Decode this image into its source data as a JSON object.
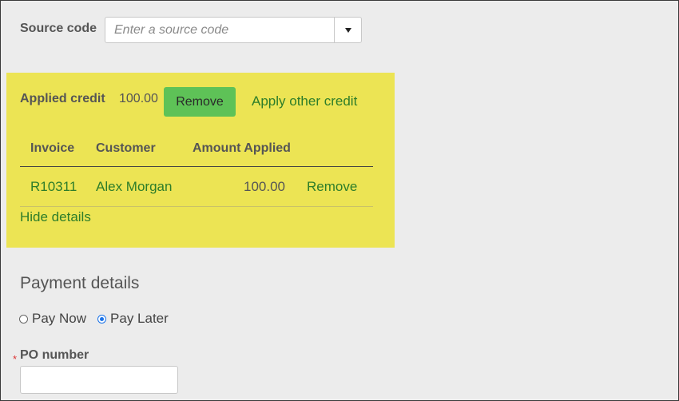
{
  "source_code": {
    "label": "Source code",
    "placeholder": "Enter a source code",
    "value": ""
  },
  "credit": {
    "applied_label": "Applied credit",
    "applied_amount": "100.00",
    "remove_label": "Remove",
    "apply_other_label": "Apply other credit",
    "table": {
      "headers": [
        "Invoice",
        "Customer",
        "Amount Applied"
      ],
      "rows": [
        {
          "invoice": "R10311",
          "customer": "Alex Morgan",
          "amount": "100.00",
          "action": "Remove"
        }
      ]
    },
    "hide_details_label": "Hide details",
    "highlight_color": "#ece454",
    "button_color": "#5ec257",
    "link_color": "#2d7d2a"
  },
  "payment": {
    "heading": "Payment details",
    "options": [
      {
        "label": "Pay Now",
        "selected": false
      },
      {
        "label": "Pay Later",
        "selected": true
      }
    ],
    "po_label": "PO number",
    "po_required_mark": "*",
    "po_value": ""
  },
  "icons": {
    "dropdown": "chevron-down-icon",
    "radio_unchecked": "radio-unchecked-icon",
    "radio_checked": "radio-checked-icon"
  }
}
